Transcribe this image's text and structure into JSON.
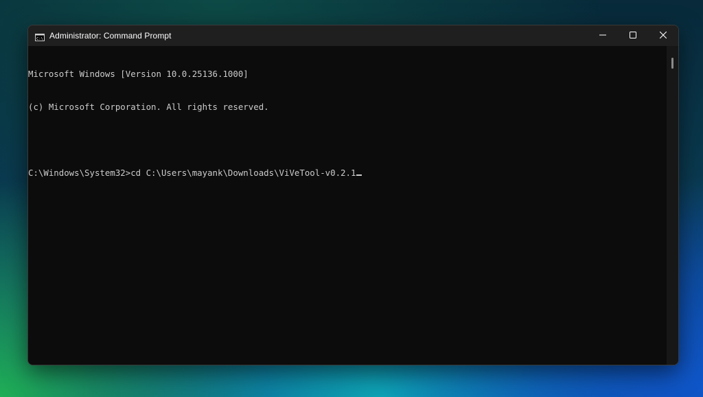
{
  "window": {
    "title": "Administrator: Command Prompt",
    "app_icon": "command-prompt-icon"
  },
  "controls": {
    "minimize_icon": "minimize-icon",
    "maximize_icon": "maximize-icon",
    "close_icon": "close-icon"
  },
  "terminal": {
    "lines": [
      "Microsoft Windows [Version 10.0.25136.1000]",
      "(c) Microsoft Corporation. All rights reserved.",
      "",
      "C:\\Windows\\System32>cd C:\\Users\\mayank\\Downloads\\ViVeTool-v0.2.1"
    ]
  },
  "colors": {
    "terminal_background": "#0c0c0c",
    "terminal_text": "#cccccc",
    "titlebar": "#1f1f1f"
  }
}
